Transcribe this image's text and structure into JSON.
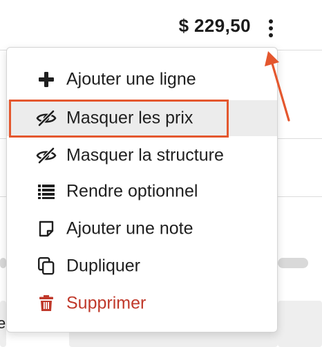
{
  "header": {
    "price": "$ 229,50",
    "more_options_icon": "more-vertical-icon"
  },
  "menu": {
    "items": [
      {
        "label": "Ajouter une ligne",
        "icon": "plus-icon",
        "color": "#1f1f1f"
      },
      {
        "label": "Masquer les prix",
        "icon": "eye-slash-icon",
        "color": "#1f1f1f",
        "highlighted": true
      },
      {
        "label": "Masquer la structure",
        "icon": "eye-slash-icon",
        "color": "#1f1f1f"
      },
      {
        "label": "Rendre optionnel",
        "icon": "list-icon",
        "color": "#1f1f1f"
      },
      {
        "label": "Ajouter une note",
        "icon": "note-icon",
        "color": "#1f1f1f"
      },
      {
        "label": "Dupliquer",
        "icon": "copy-icon",
        "color": "#1f1f1f"
      },
      {
        "label": "Supprimer",
        "icon": "trash-icon",
        "color": "#c0392b"
      }
    ]
  },
  "background": {
    "partial_cell_text": "e"
  },
  "annotation": {
    "highlight_color": "#e4572e"
  }
}
